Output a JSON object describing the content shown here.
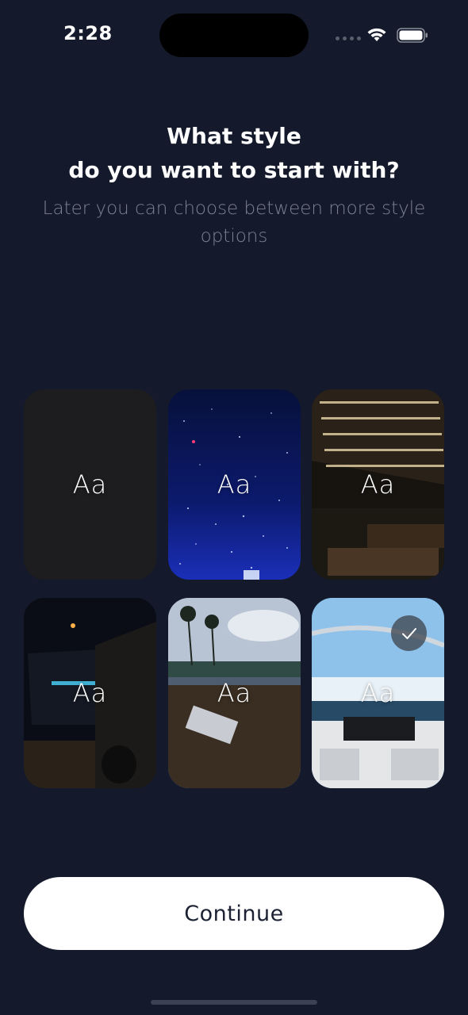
{
  "status_bar": {
    "time": "2:28",
    "signal_icon": "cellular-dots-icon",
    "wifi_icon": "wifi-icon",
    "battery_icon": "battery-icon"
  },
  "heading": {
    "title_line1": "What style",
    "title_line2": "do you want to start with?",
    "subtitle": "Later you can choose between more style options"
  },
  "styles": [
    {
      "label": "Aa",
      "theme": "plain dark",
      "selected": false
    },
    {
      "label": "Aa",
      "theme": "starry night sky",
      "selected": false
    },
    {
      "label": "Aa",
      "theme": "hotel at night",
      "selected": false
    },
    {
      "label": "Aa",
      "theme": "cars at night",
      "selected": false
    },
    {
      "label": "Aa",
      "theme": "tropical terrace",
      "selected": false
    },
    {
      "label": "Aa",
      "theme": "speedboat at sea",
      "selected": true
    }
  ],
  "continue_button": {
    "label": "Continue"
  },
  "colors": {
    "background": "#141a2b",
    "button_bg": "#ffffff",
    "button_text": "#1c2233",
    "subtitle": "#7c8190"
  }
}
